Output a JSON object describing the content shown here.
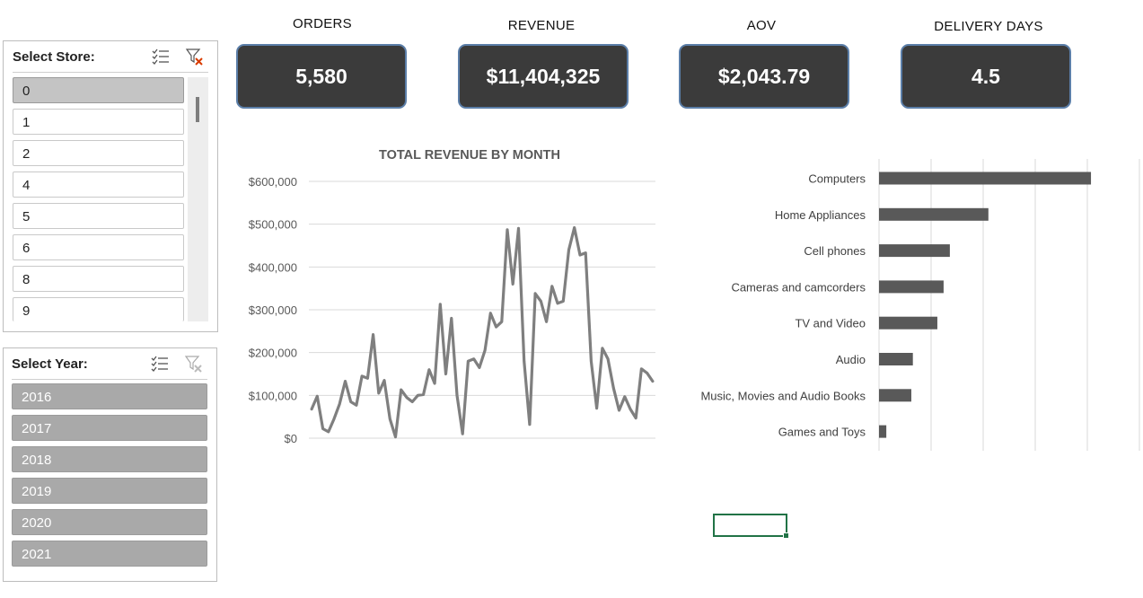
{
  "store_slicer": {
    "title": "Select Store:",
    "items": [
      {
        "label": "0",
        "selected": true
      },
      {
        "label": "1",
        "selected": false
      },
      {
        "label": "2",
        "selected": false
      },
      {
        "label": "4",
        "selected": false
      },
      {
        "label": "5",
        "selected": false
      },
      {
        "label": "6",
        "selected": false
      },
      {
        "label": "8",
        "selected": false
      },
      {
        "label": "9",
        "selected": false
      }
    ]
  },
  "year_slicer": {
    "title": "Select Year:",
    "items": [
      {
        "label": "2016"
      },
      {
        "label": "2017"
      },
      {
        "label": "2018"
      },
      {
        "label": "2019"
      },
      {
        "label": "2020"
      },
      {
        "label": "2021"
      }
    ]
  },
  "kpis": {
    "orders": {
      "label": "ORDERS",
      "value": "5,580"
    },
    "revenue": {
      "label": "REVENUE",
      "value": "$11,404,325"
    },
    "aov": {
      "label": "AOV",
      "value": "$2,043.79"
    },
    "delivery_days": {
      "label": "DELIVERY DAYS",
      "value": "4.5"
    }
  },
  "colors": {
    "kpi_card_bg": "#3b3b3b",
    "kpi_card_border": "#5b7ea8",
    "line_series": "#7f7f7f",
    "bar_series": "#595959",
    "selected_item": "#c4c4c4",
    "year_item": "#a9a9a9",
    "active_cell": "#217346"
  },
  "icons": {
    "multi_select": "multi-select-icon",
    "clear_filter": "clear-filter-icon"
  },
  "chart_data": [
    {
      "type": "line",
      "title": "TOTAL REVENUE BY MONTH",
      "xlabel": "",
      "ylabel": "",
      "ylim": [
        0,
        600000
      ],
      "yticks": [
        0,
        100000,
        200000,
        300000,
        400000,
        500000,
        600000
      ],
      "ytick_labels": [
        "$0",
        "$100,000",
        "$200,000",
        "$300,000",
        "$400,000",
        "$500,000",
        "$600,000"
      ],
      "grid": true,
      "series": [
        {
          "values": [
            68000,
            98000,
            22000,
            15000,
            45000,
            80000,
            133000,
            85000,
            77000,
            145000,
            140000,
            242000,
            105000,
            135000,
            45000,
            3000,
            113000,
            95000,
            85000,
            100000,
            102000,
            160000,
            128000,
            313000,
            150000,
            280000,
            100000,
            10000,
            180000,
            185000,
            165000,
            205000,
            292000,
            260000,
            272000,
            487000,
            360000,
            490000,
            180000,
            32000,
            338000,
            320000,
            272000,
            355000,
            315000,
            320000,
            440000,
            492000,
            428000,
            433000,
            180000,
            70000,
            210000,
            185000,
            117000,
            65000,
            97000,
            68000,
            47000,
            162000,
            152000,
            133000
          ]
        }
      ]
    },
    {
      "type": "bar",
      "orientation": "horizontal",
      "title": "",
      "categories": [
        "Computers",
        "Home Appliances",
        "Cell phones",
        "Cameras and camcorders",
        "TV and Video",
        "Audio",
        "Music, Movies and Audio Books",
        "Games and Toys"
      ],
      "values": [
        4070000,
        2100000,
        1360000,
        1240000,
        1120000,
        650000,
        620000,
        140000
      ],
      "xlim": [
        0,
        5000000
      ],
      "grid": true
    }
  ]
}
